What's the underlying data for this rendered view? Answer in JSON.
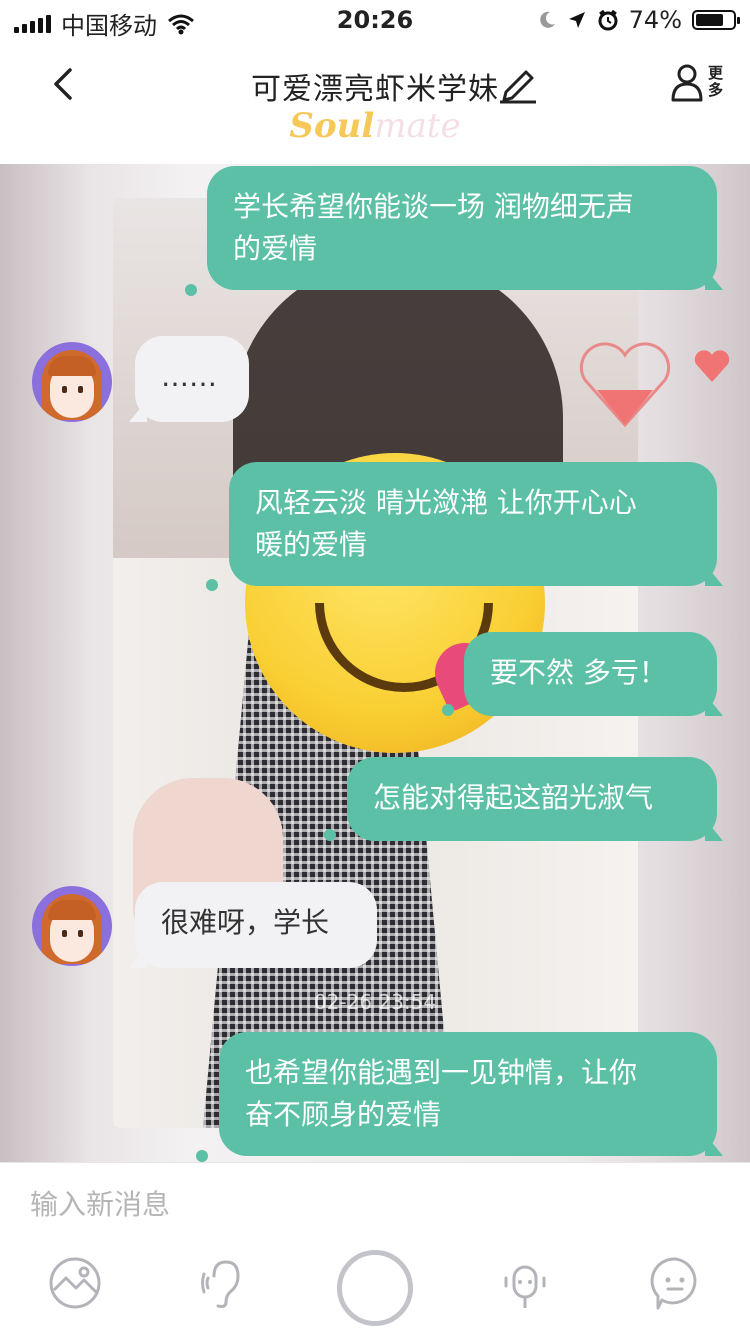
{
  "status_bar": {
    "carrier": "中国移动",
    "time": "20:26",
    "battery": "74%",
    "battery_level": 0.74
  },
  "header": {
    "title": "可爱漂亮虾米学妹",
    "more_label_line1": "更",
    "more_label_line2": "多",
    "logo_soul": "Soul",
    "logo_mate": "mate"
  },
  "messages": [
    {
      "id": "m1",
      "direction": "out",
      "lines": [
        "学长希望你能谈一场 润物细无声",
        "的爱情"
      ]
    },
    {
      "id": "m2",
      "direction": "in",
      "lines": [
        "……"
      ]
    },
    {
      "id": "m3",
      "direction": "out",
      "lines": [
        "风轻云淡 晴光潋滟 让你开心心",
        "暖的爱情"
      ]
    },
    {
      "id": "m4",
      "direction": "out",
      "lines": [
        "要不然 多亏！"
      ]
    },
    {
      "id": "m5",
      "direction": "out",
      "lines": [
        "怎能对得起这韶光淑气"
      ]
    },
    {
      "id": "m6",
      "direction": "in",
      "lines": [
        "很难呀，学长"
      ]
    },
    {
      "id": "m7",
      "direction": "out",
      "lines": [
        "也希望你能遇到一见钟情，让你",
        "奋不顾身的爱情"
      ]
    }
  ],
  "timestamp": "02-26 23:54",
  "input": {
    "placeholder": "输入新消息"
  },
  "toolbar_icons": [
    "image-icon",
    "listen-icon",
    "record-button",
    "microphone-icon",
    "emoji-icon"
  ],
  "colors": {
    "accent": "#5bc0a6",
    "incoming_bubble": "#f2f2f4",
    "logo_yellow": "#f6c85a",
    "heart": "#f07474"
  }
}
